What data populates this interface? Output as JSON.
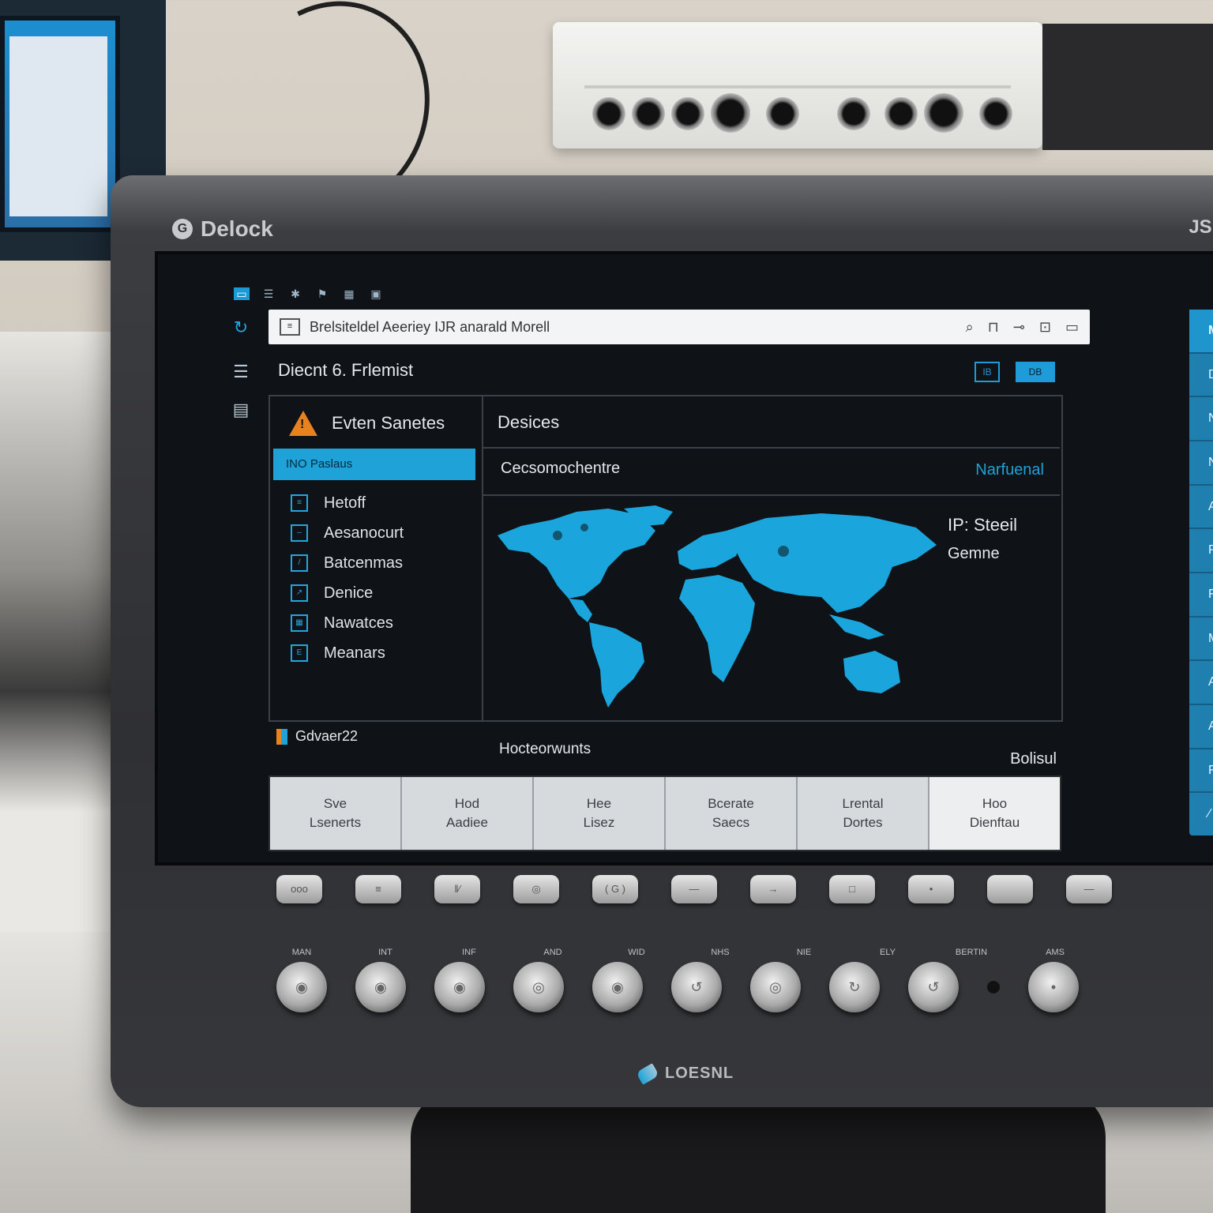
{
  "device": {
    "brand": "Delock",
    "brand_right": "JSU",
    "bottom_brand": "LOESNL"
  },
  "top_icons": [
    "screen-icon",
    "list-icon",
    "tools-icon",
    "flag-icon",
    "grid-icon",
    "window-icon"
  ],
  "left_rail_icons": [
    "refresh-icon",
    "menu-icon",
    "panel-icon"
  ],
  "address_bar": {
    "text": "Brelsiteldel Aeeriey IJR anarald Morell",
    "tool_icons": [
      "search-icon",
      "bookmark-icon",
      "key-icon",
      "card-icon",
      "screen-icon"
    ]
  },
  "page": {
    "title": "Diecnt 6. Frlemist",
    "title_buttons": [
      "IB",
      "DB"
    ]
  },
  "events": {
    "header": "Evten Sanetes",
    "selected": "INO Paslaus",
    "items": [
      "Hetoff",
      "Aesanocurt",
      "Batcenmas",
      "Denice",
      "Nawatces",
      "Meanars"
    ]
  },
  "devices": {
    "header": "Desices",
    "row_label": "Cecsomochentre",
    "row_value": "Narfuenal",
    "map_label1": "IP: Steeil",
    "map_label2": "Gemne"
  },
  "footer": {
    "left": "Gdvaer22",
    "mid": "Hocteorwunts",
    "right": "Bolisul"
  },
  "tiles": [
    {
      "line1": "Sve",
      "line2": "Lsenerts"
    },
    {
      "line1": "Hod",
      "line2": "Aadiee"
    },
    {
      "line1": "Hee",
      "line2": "Lisez"
    },
    {
      "line1": "Bcerate",
      "line2": "Saecs"
    },
    {
      "line1": "Lrental",
      "line2": "Dortes"
    },
    {
      "line1": "Hoo",
      "line2": "Dienftau"
    }
  ],
  "right_menu": [
    "MBAN",
    "Don",
    "Nas",
    "NVS",
    "AI",
    "Pitt",
    "Flatici",
    "Mets",
    "Ans",
    "Aitre",
    "Fitsn",
    "∕"
  ],
  "hw_buttons": [
    "ooo",
    "≡",
    "‖∕",
    "◎",
    "( G )",
    "—",
    "→",
    "□",
    "•",
    "",
    "—"
  ],
  "knob_labels": [
    "MAN",
    "INT",
    "INF",
    "AND",
    "WID",
    "NHS",
    "NIE",
    "ELY",
    "BERTIN",
    "AMS"
  ],
  "knob_glyphs": [
    "◉",
    "◉",
    "◉",
    "◎",
    "◉",
    "↺",
    "◎",
    "↻",
    "↺",
    "•"
  ]
}
